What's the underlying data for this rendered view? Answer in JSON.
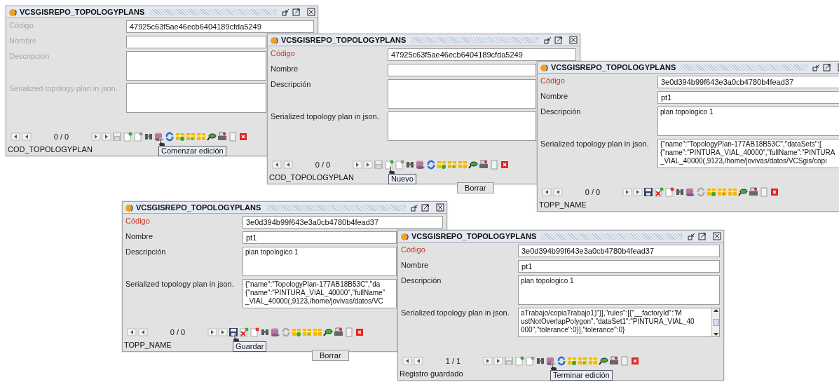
{
  "windows": [
    {
      "title": "VCSGISREPO_TOPOLOGYPLANS",
      "enabled": false,
      "editing": false,
      "fields": [
        {
          "label": "Código",
          "required": false,
          "kind": "line",
          "value": "47925c63f5ae46ecb6404189cfda5249"
        },
        {
          "label": "Nombre",
          "required": false,
          "kind": "line"
        },
        {
          "label": "Descripción",
          "required": false,
          "kind": "area"
        },
        {
          "label": "Serialized topology plan in json.",
          "required": false,
          "kind": "area"
        }
      ],
      "counter": "0 / 0",
      "status": "COD_TOPOLOGYPLAN",
      "tooltip": {
        "text": "Comenzar edición",
        "kind": "edit"
      }
    },
    {
      "title": "VCSGISREPO_TOPOLOGYPLANS",
      "enabled": true,
      "editing": false,
      "fields": [
        {
          "label": "Código",
          "required": true,
          "kind": "line",
          "value": "47925c63f5ae46ecb6404189cfda5249"
        },
        {
          "label": "Nombre",
          "required": false,
          "kind": "line"
        },
        {
          "label": "Descripción",
          "required": false,
          "kind": "area"
        },
        {
          "label": "Serialized topology plan in json.",
          "required": false,
          "kind": "area"
        }
      ],
      "counter": "0 / 0",
      "status": "COD_TOPOLOGYPLAN",
      "tooltip": {
        "text": "Nuevo",
        "kind": "new"
      },
      "button_below": "Borrar"
    },
    {
      "title": "VCSGISREPO_TOPOLOGYPLANS",
      "enabled": true,
      "editing": true,
      "fields": [
        {
          "label": "Código",
          "required": true,
          "kind": "line",
          "value": "3e0d394b99f643e3a0cb4780b4fead37"
        },
        {
          "label": "Nombre",
          "required": false,
          "kind": "line",
          "value": "pt1"
        },
        {
          "label": "Descripción",
          "required": false,
          "kind": "area",
          "lines": [
            "plan topologico 1"
          ]
        },
        {
          "label": "Serialized topology plan in json.",
          "required": false,
          "kind": "area",
          "lines": [
            "{\"name\":\"TopologyPlan-177AB18B53C\",\"dataSets\":[",
            "{\"name\":\"PINTURA_VIAL_40000\",\"fullName\":\"PINTURA",
            "_VIAL_40000(,9123,/home/jovivas/datos/VCSgis/copi"
          ]
        }
      ],
      "counter": "0 / 0",
      "status": "TOPP_NAME"
    },
    {
      "title": "VCSGISREPO_TOPOLOGYPLANS",
      "enabled": true,
      "editing": true,
      "fields": [
        {
          "label": "Código",
          "required": true,
          "kind": "line",
          "value": "3e0d394b99f643e3a0cb4780b4fead37"
        },
        {
          "label": "Nombre",
          "required": false,
          "kind": "line",
          "value": "pt1"
        },
        {
          "label": "Descripción",
          "required": false,
          "kind": "area",
          "lines": [
            "plan topologico 1"
          ]
        },
        {
          "label": "Serialized topology plan in json.",
          "required": false,
          "kind": "area",
          "lines": [
            "{\"name\":\"TopologyPlan-177AB18B53C\",\"da",
            "{\"name\":\"PINTURA_VIAL_40000\",\"fullName\"",
            "_VIAL_40000(,9123,/home/jovivas/datos/VC"
          ]
        }
      ],
      "counter": "0 / 0",
      "status": "TOPP_NAME",
      "tooltip": {
        "text": "Guardar",
        "kind": "save"
      },
      "button_below": "Borrar"
    },
    {
      "title": "VCSGISREPO_TOPOLOGYPLANS",
      "enabled": true,
      "editing": false,
      "fields": [
        {
          "label": "Código",
          "required": true,
          "kind": "line",
          "value": "3e0d394b99f643e3a0cb4780b4fead37"
        },
        {
          "label": "Nombre",
          "required": false,
          "kind": "line",
          "value": "pt1"
        },
        {
          "label": "Descripción",
          "required": false,
          "kind": "area",
          "lines": [
            "plan topologico 1"
          ]
        },
        {
          "label": "Serialized topology plan in json.",
          "required": false,
          "kind": "scroll",
          "lines": [
            "aTrabajo/copiaTrabajo1)\"}],\"rules\":[{\"__factoryId\":\"M",
            "ustNotOverlapPolygon\",\"dataSet1\":\"PINTURA_VIAL_40",
            "000\",\"tolerance\":0}],\"tolerance\":0}"
          ]
        }
      ],
      "counter": "1 / 1",
      "status": "Registro guardado",
      "tooltip": {
        "text": "Terminar edición",
        "kind": "edit"
      }
    }
  ]
}
